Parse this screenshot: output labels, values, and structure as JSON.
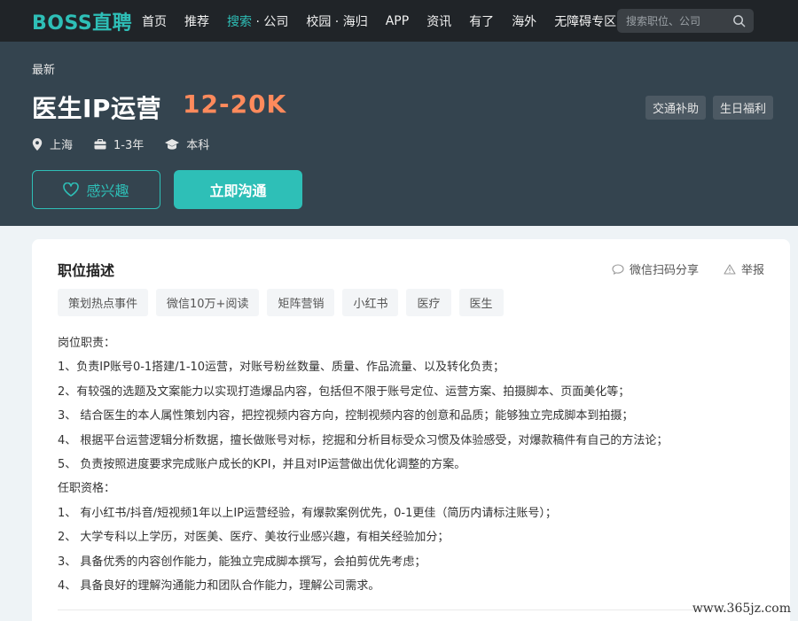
{
  "nav": {
    "logo": "BOSS直聘",
    "items": [
      {
        "label": "首页"
      },
      {
        "label": "推荐"
      },
      {
        "label": "搜索",
        "suffix": "· 公司"
      },
      {
        "label": "校园 · 海归"
      },
      {
        "label": "APP"
      },
      {
        "label": "资讯"
      },
      {
        "label": "有了"
      },
      {
        "label": "海外"
      },
      {
        "label": "无障碍专区"
      }
    ],
    "search_placeholder": "搜索职位、公司"
  },
  "job": {
    "tag": "最新",
    "title": "医生IP运营",
    "salary": "12-20K",
    "location": "上海",
    "experience": "1-3年",
    "education": "本科",
    "benefits": [
      "交通补助",
      "生日福利"
    ],
    "interest_label": "感兴趣",
    "chat_label": "立即沟通"
  },
  "detail": {
    "section_title": "职位描述",
    "share_label": "微信扫码分享",
    "report_label": "举报",
    "skills": [
      "策划热点事件",
      "微信10万+阅读",
      "矩阵营销",
      "小红书",
      "医疗",
      "医生"
    ],
    "lines": [
      "岗位职责：",
      "1、负责IP账号0-1搭建/1-10运营，对账号粉丝数量、质量、作品流量、以及转化负责；",
      "2、有较强的选题及文案能力以实现打造爆品内容，包括但不限于账号定位、运营方案、拍摄脚本、页面美化等；",
      "3、 结合医生的本人属性策划内容，把控视频内容方向，控制视频内容的创意和品质；能够独立完成脚本到拍摄；",
      "4、 根据平台运营逻辑分析数据，擅长做账号对标，挖掘和分析目标受众习惯及体验感受，对爆款稿件有自己的方法论；",
      "5、 负责按照进度要求完成账户成长的KPI，并且对IP运营做出优化调整的方案。",
      "任职资格：",
      "1、 有小红书/抖音/短视频1年以上IP运营经验，有爆款案例优先，0-1更佳（简历内请标注账号）；",
      "2、 大学专科以上学历，对医美、医疗、美妆行业感兴趣，有相关经验加分；",
      "3、 具备优秀的内容创作能力，能独立完成脚本撰写，会拍剪优先考虑；",
      "4、 具备良好的理解沟通能力和团队合作能力，理解公司需求。"
    ]
  },
  "watermark": "www.365jz.com",
  "colors": {
    "brand": "#2ebfb7",
    "salary": "#ff8a5c",
    "nav_bg": "#202428",
    "banner_bg": "#34444f"
  }
}
